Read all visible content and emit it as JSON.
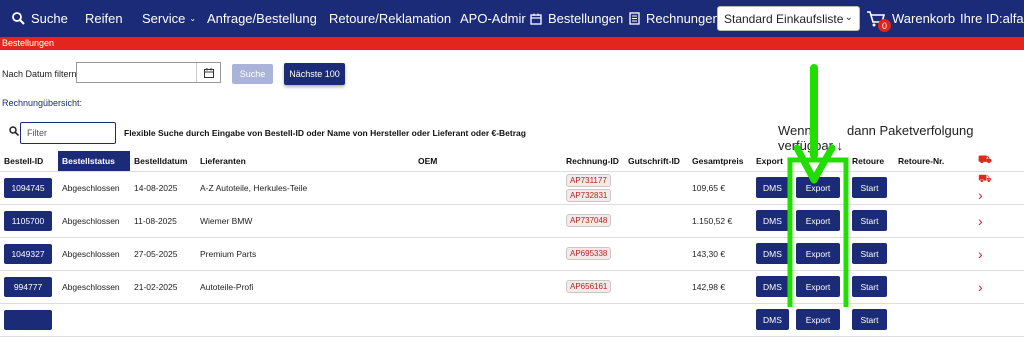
{
  "nav": {
    "suche": "Suche",
    "reifen": "Reifen",
    "service": "Service",
    "anfrage": "Anfrage/Bestellung",
    "retoure": "Retoure/Reklamation",
    "apo": "APO-Admir",
    "bestellungen": "Bestellungen",
    "rechnungen": "Rechnungen",
    "list_select": "Standard Einkaufsliste",
    "cart_count": "0",
    "warenkorb": "Warenkorb",
    "user_id": "Ihre ID:alfah"
  },
  "section_title": "Bestellungen",
  "filter": {
    "label": "Nach Datum filtern:",
    "date_value": "",
    "search_btn": "Suche",
    "next_btn": "Nächste 100"
  },
  "rechnung_label": "Rechnungübersicht:",
  "search": {
    "placeholder": "Filter",
    "hint": "Flexible Suche durch Eingabe von Bestell-ID oder Name von Hersteller oder Lieferant oder €-Betrag"
  },
  "wenn_text": "Wenn",
  "wenn_text2": "dann Paketverfolgung verfügbar",
  "table": {
    "headers": [
      "Bestell-ID",
      "Bestellstatus",
      "Bestelldatum",
      "Lieferanten",
      "OEM",
      "Rechnung-ID",
      "Gutschrift-ID",
      "Gesamtpreis",
      "Export",
      "",
      "Retoure",
      "Retoure-Nr."
    ],
    "rows": [
      {
        "id": "1094745",
        "status": "Abgeschlossen",
        "date": "14-08-2025",
        "supplier": "A-Z Autoteile, Herkules-Teile",
        "oem": "",
        "rechnung": [
          "AP731177",
          "AP732831"
        ],
        "gutschrift": "",
        "price": "109,65 €",
        "dms": "DMS",
        "export": "Export",
        "start": "Start"
      },
      {
        "id": "1105700",
        "status": "Abgeschlossen",
        "date": "11-08-2025",
        "supplier": "Wiemer BMW",
        "oem": "",
        "rechnung": [
          "AP737048"
        ],
        "gutschrift": "",
        "price": "1.150,52 €",
        "dms": "DMS",
        "export": "Export",
        "start": "Start"
      },
      {
        "id": "1049327",
        "status": "Abgeschlossen",
        "date": "27-05-2025",
        "supplier": "Premium Parts",
        "oem": "",
        "rechnung": [
          "AP695338"
        ],
        "gutschrift": "",
        "price": "143,30 €",
        "dms": "DMS",
        "export": "Export",
        "start": "Start"
      },
      {
        "id": "994777",
        "status": "Abgeschlossen",
        "date": "21-02-2025",
        "supplier": "Autoteile-Profi",
        "oem": "",
        "rechnung": [
          "AP656161"
        ],
        "gutschrift": "",
        "price": "142,98 €",
        "dms": "DMS",
        "export": "Export",
        "start": "Start"
      },
      {
        "id": "",
        "status": "",
        "date": "",
        "supplier": "",
        "oem": "",
        "rechnung": [],
        "gutschrift": "",
        "price": "",
        "dms": "DMS",
        "export": "Export",
        "start": "Start"
      }
    ]
  },
  "colors": {
    "nav_bg": "#1c2b78",
    "red_bar": "#e2261d",
    "highlight_green": "#22dd00"
  }
}
